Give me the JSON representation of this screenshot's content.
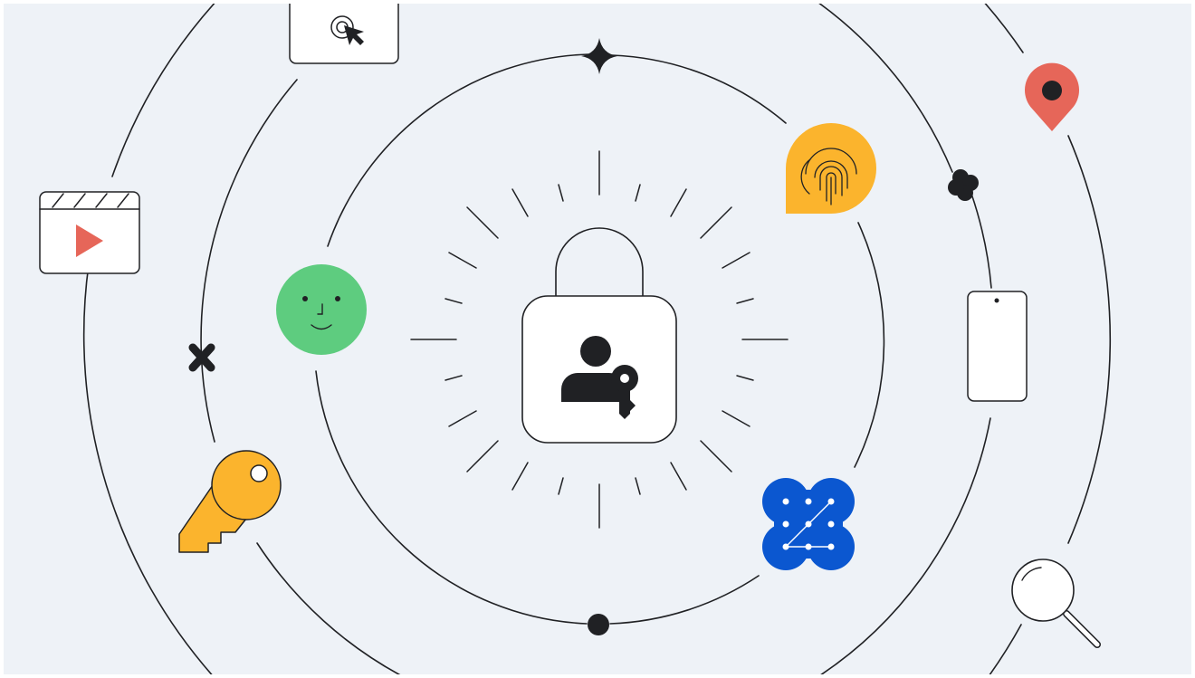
{
  "theme": {
    "background": "#eef2f7",
    "frame": "#ffffff",
    "ink": "#202124",
    "card": "#ffffff",
    "red": "#e66659",
    "yellow": "#fbb42d",
    "green": "#5ecc7f",
    "blue": "#0b57d0"
  },
  "icons": [
    "padlock-icon",
    "user-key-icon",
    "fingerprint-icon",
    "face-icon",
    "key-icon",
    "pattern-lock-icon",
    "smartphone-icon",
    "location-pin-icon",
    "video-player-icon",
    "cursor-click-icon",
    "magnifier-icon",
    "sparkle-icon"
  ]
}
